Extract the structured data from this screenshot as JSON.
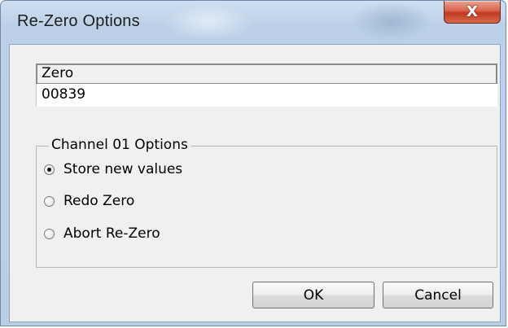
{
  "window": {
    "title": "Re-Zero Options",
    "close_glyph": "X",
    "close_icon": "close-icon"
  },
  "zero": {
    "header": "Zero",
    "value": "00839"
  },
  "options_group": {
    "legend": "Channel 01 Options",
    "options": [
      {
        "label": "Store new values",
        "checked": true
      },
      {
        "label": "Redo Zero",
        "checked": false
      },
      {
        "label": "Abort Re-Zero",
        "checked": false
      }
    ]
  },
  "buttons": {
    "ok": "OK",
    "cancel": "Cancel"
  },
  "colors": {
    "title_bar": "#bcd1e8",
    "close_button": "#c2391f",
    "dialog_background": "#f0f0f0"
  }
}
